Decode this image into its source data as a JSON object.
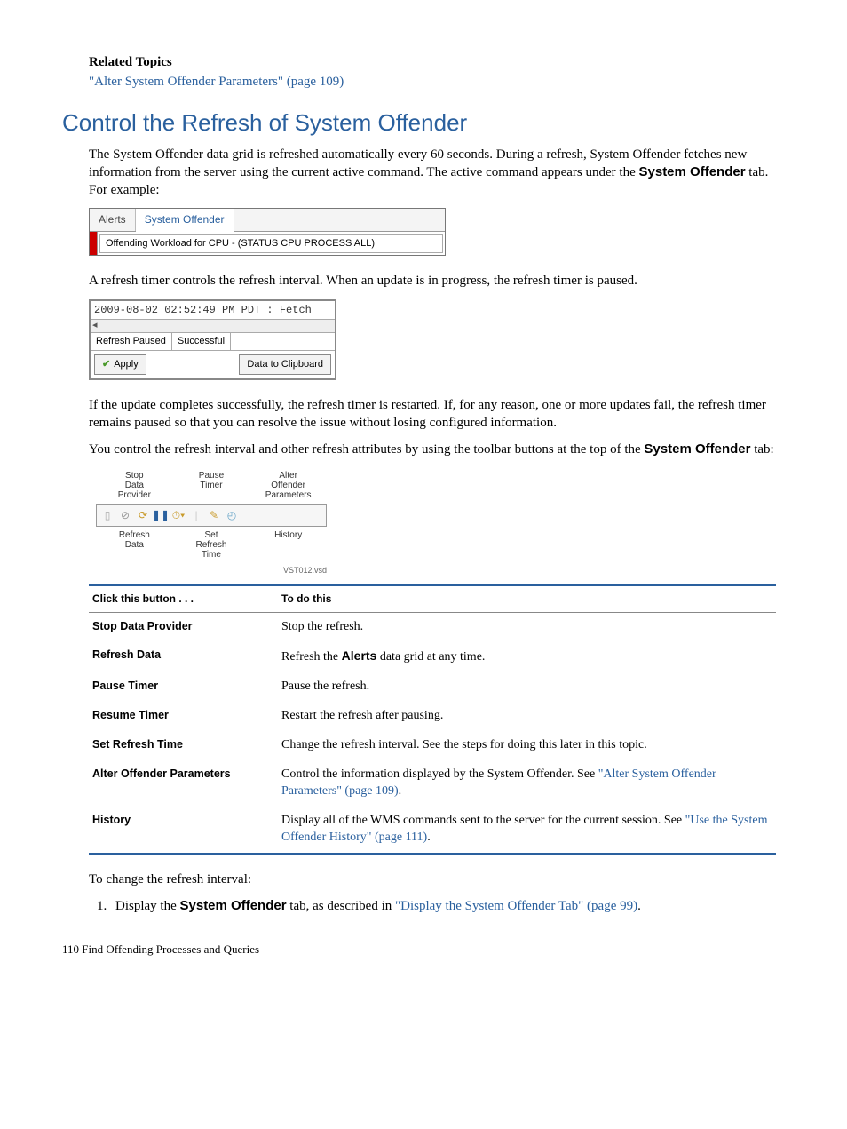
{
  "related": {
    "heading": "Related Topics",
    "link": "\"Alter System Offender Parameters\" (page 109)"
  },
  "section_title": "Control the Refresh of System Offender",
  "para1_a": "The System Offender data grid is refreshed automatically every 60 seconds. During a refresh, System Offender fetches new information from the server using the current active command. The active command appears under the ",
  "para1_b": "System Offender",
  "para1_c": " tab. For example:",
  "fig1": {
    "tab_alerts": "Alerts",
    "tab_so": "System Offender",
    "cmd": "Offending Workload for CPU - (STATUS CPU PROCESS ALL)"
  },
  "para2": "A refresh timer controls the refresh interval. When an update is in progress, the refresh timer is paused.",
  "fig2": {
    "mono": "2009-08-02 02:52:49 PM PDT : Fetch",
    "status_a": "Refresh Paused",
    "status_b": "Successful",
    "btn_apply": "Apply",
    "btn_clip": "Data to Clipboard"
  },
  "para3": "If the update completes successfully, the refresh timer is restarted. If, for any reason, one or more updates fail, the refresh timer remains paused so that you can resolve the issue without losing configured information.",
  "para4_a": "You control the refresh interval and other refresh attributes by using the toolbar buttons at the top of the ",
  "para4_b": "System Offender",
  "para4_c": " tab:",
  "fig3": {
    "lbl_stop": "Stop\nData\nProvider",
    "lbl_pause": "Pause\nTimer",
    "lbl_alter": "Alter\nOffender\nParameters",
    "lbl_refresh": "Refresh\nData",
    "lbl_set": "Set\nRefresh\nTime",
    "lbl_history": "History",
    "caption": "VST012.vsd"
  },
  "table": {
    "h1": "Click this button . . .",
    "h2": "To do this",
    "rows": [
      {
        "label": "Stop Data Provider",
        "desc": "Stop the refresh."
      },
      {
        "label": "Refresh Data",
        "desc_a": "Refresh the ",
        "desc_b": "Alerts",
        "desc_c": " data grid at any time."
      },
      {
        "label": "Pause Timer",
        "desc": "Pause the refresh."
      },
      {
        "label": "Resume Timer",
        "desc": "Restart the refresh after pausing."
      },
      {
        "label": "Set Refresh Time",
        "desc": "Change the refresh interval. See the steps for doing this later in this topic."
      },
      {
        "label": "Alter Offender Parameters",
        "desc_a": "Control the information displayed by the System Offender. See ",
        "desc_link": "\"Alter System Offender Parameters\" (page 109)",
        "desc_c": "."
      },
      {
        "label": "History",
        "desc_a": "Display all of the WMS commands sent to the server for the current session. See ",
        "desc_link": "\"Use the System Offender History\" (page 111)",
        "desc_c": "."
      }
    ]
  },
  "para5": "To change the refresh interval:",
  "step1_a": "Display the ",
  "step1_b": "System Offender",
  "step1_c": " tab, as described in ",
  "step1_link": "\"Display the System Offender Tab\" (page 99)",
  "step1_d": ".",
  "footer": "110    Find Offending Processes and Queries"
}
